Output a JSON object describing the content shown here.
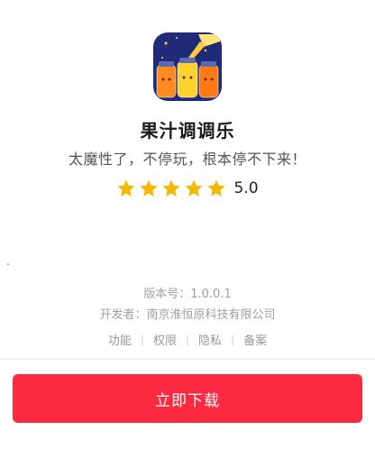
{
  "app": {
    "name": "果汁调调乐",
    "slogan": "太魔性了，不停玩，根本停不下来！",
    "rating_value": "5.0",
    "rating_stars": 5,
    "icon": "juice-jars-app-icon"
  },
  "meta": {
    "version": "版本号：1.0.0.1",
    "developer": "开发者：南京淮恒原科技有限公司"
  },
  "links": {
    "features": "功能",
    "permissions": "权限",
    "privacy": "隐私",
    "filing": "备案",
    "separator": "|"
  },
  "actions": {
    "download_label": "立即下载"
  },
  "colors": {
    "star": "#f5b800",
    "button": "#fb2a40",
    "muted_text": "#a0a0a0"
  }
}
